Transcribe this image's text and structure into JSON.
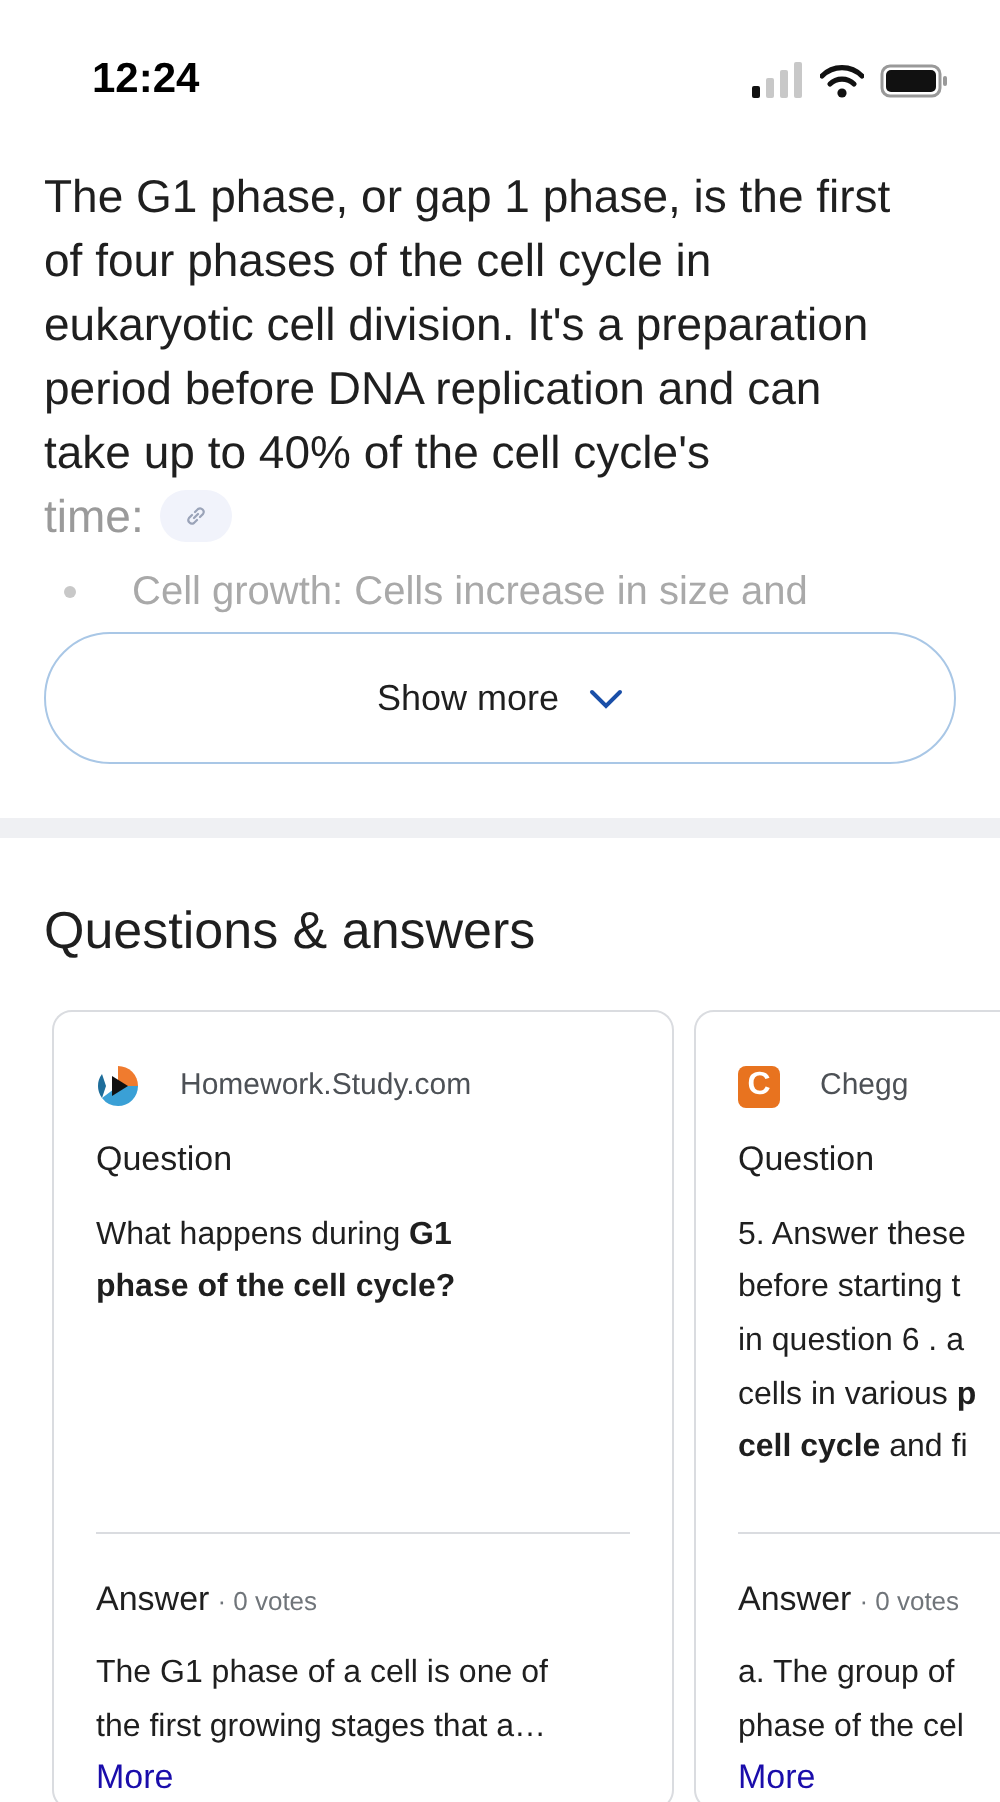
{
  "status_bar": {
    "time": "12:24"
  },
  "overview": {
    "text": "The G1 phase, or gap 1 phase, is the first of four phases of the cell cycle in eukaryotic cell division. It's a preparation period before DNA replication and can take up to 40% of the cell cycle's",
    "faded_text": "time:",
    "bullet": "Cell growth: Cells increase in size and",
    "button": "Show more"
  },
  "questions_section": {
    "title": "Questions & answers",
    "cards": [
      {
        "source": "Homework.Study.com",
        "question_label": "Question",
        "question_lines": [
          "What happens during **G1**",
          "**phase of the cell cycle?**"
        ],
        "answer_label": "Answer",
        "votes": "· 0 votes",
        "answer_lines": [
          "The G1 phase of a cell is one of",
          "the first growing stages that a…"
        ],
        "more": "More"
      },
      {
        "source": "Chegg",
        "logo_letter": "C",
        "question_label": "Question",
        "question_lines": [
          "5. Answer these",
          "before starting t",
          "in question 6 . a",
          "cells in various **p**",
          "**cell cycle** and fi"
        ],
        "answer_label": "Answer",
        "votes": "· 0 votes",
        "answer_lines": [
          "a. The group of",
          "phase of the cel"
        ],
        "more": "More"
      }
    ]
  }
}
